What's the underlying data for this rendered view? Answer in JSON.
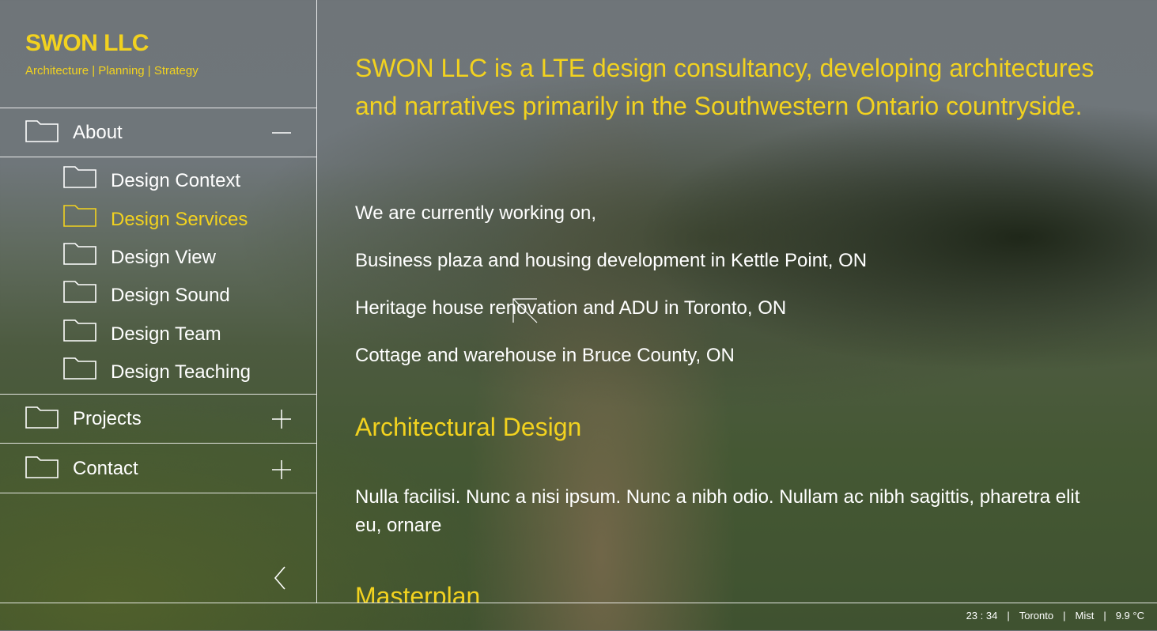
{
  "brand": {
    "title": "SWON LLC",
    "subtitle": "Architecture | Planning | Strategy"
  },
  "nav": {
    "about": {
      "label": "About",
      "toggle_icon": "minus-icon"
    },
    "about_items": [
      {
        "label": "Design Context",
        "active": false
      },
      {
        "label": "Design Services",
        "active": true
      },
      {
        "label": "Design View",
        "active": false
      },
      {
        "label": "Design Sound",
        "active": false
      },
      {
        "label": "Design Team",
        "active": false
      },
      {
        "label": "Design Teaching",
        "active": false
      }
    ],
    "projects": {
      "label": "Projects",
      "toggle_icon": "plus-icon"
    },
    "contact": {
      "label": "Contact",
      "toggle_icon": "plus-icon"
    },
    "collapse_icon": "chevron-left-icon"
  },
  "main": {
    "intro": "SWON LLC is a LTE design consultancy, developing architectures and narratives primarily in the Southwestern Ontario countryside.",
    "working_on": "We are currently working on,",
    "projects": [
      "Business plaza and housing development in Kettle Point, ON",
      "Heritage house renovation and ADU in Toronto, ON",
      "Cottage and warehouse in Bruce County, ON"
    ],
    "section1": {
      "heading": "Architectural Design",
      "body": "Nulla facilisi. Nunc a nisi ipsum. Nunc a nibh odio. Nullam ac nibh sagittis, pharetra elit eu, ornare"
    },
    "section2": {
      "heading": "Masterplan"
    }
  },
  "status": {
    "time": "23 : 34",
    "city": "Toronto",
    "weather": "Mist",
    "temp": "9.9 °C"
  },
  "colors": {
    "accent": "#f2d21f",
    "text": "#ffffff",
    "line": "#ffffff"
  }
}
